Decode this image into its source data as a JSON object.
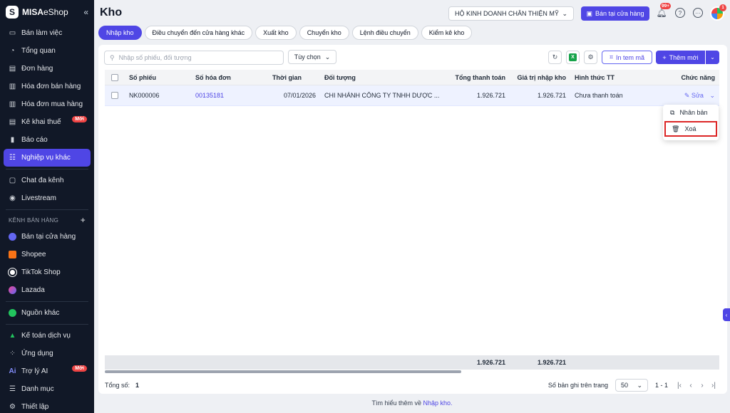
{
  "sidebar": {
    "brand": "MISA",
    "brand_suffix": "eShop",
    "items": [
      {
        "label": "Bán làm việc",
        "icon": "desk-icon"
      },
      {
        "label": "Tổng quan",
        "icon": "dashboard-icon"
      },
      {
        "label": "Đơn hàng",
        "icon": "order-icon"
      },
      {
        "label": "Hóa đơn bán hàng",
        "icon": "invoice-icon"
      },
      {
        "label": "Hóa đơn mua hàng",
        "icon": "purchase-invoice-icon"
      },
      {
        "label": "Kê khai thuế",
        "icon": "tax-icon",
        "badge": "Mới"
      },
      {
        "label": "Báo cáo",
        "icon": "report-icon"
      },
      {
        "label": "Nghiệp vụ khác",
        "icon": "operations-icon",
        "active": true
      }
    ],
    "items2": [
      {
        "label": "Chat đa kênh",
        "icon": "chat-icon"
      },
      {
        "label": "Livestream",
        "icon": "livestream-icon"
      }
    ],
    "channels_title": "KÊNH BÁN HÀNG",
    "channels": [
      {
        "label": "Bán tại cửa hàng",
        "color": "#6366f1"
      },
      {
        "label": "Shopee",
        "color": "#f97316"
      },
      {
        "label": "TikTok Shop",
        "color": "#ffffff"
      },
      {
        "label": "Lazada",
        "color": "#ec4899"
      }
    ],
    "other_source": "Nguồn khác",
    "items3": [
      {
        "label": "Kế toán dịch vụ",
        "icon": "accounting-icon"
      },
      {
        "label": "Ứng dụng",
        "icon": "apps-icon"
      },
      {
        "label": "Trợ lý AI",
        "icon": "ai-icon",
        "badge": "Mới"
      },
      {
        "label": "Danh mục",
        "icon": "catalog-icon"
      },
      {
        "label": "Thiết lập",
        "icon": "settings-icon"
      }
    ]
  },
  "header": {
    "title": "Kho",
    "store": "HỘ KINH DOANH CHÂN THIỆN MỸ",
    "sell_button": "Bán tại cửa hàng",
    "notif_count": "99+",
    "avatar_badge": "1"
  },
  "tabs": [
    "Nhập kho",
    "Điều chuyển đến cửa hàng khác",
    "Xuất kho",
    "Chuyển kho",
    "Lệnh điều chuyển",
    "Kiểm kê kho"
  ],
  "toolbar": {
    "search_placeholder": "Nhập số phiếu, đối tượng",
    "filter_label": "Tùy chọn",
    "excel_label": "X",
    "print_label": "In tem mã",
    "add_label": "Thêm mới"
  },
  "table": {
    "columns": [
      "Số phiếu",
      "Số hóa đơn",
      "Thời gian",
      "Đối tượng",
      "Tổng thanh toán",
      "Giá trị nhập kho",
      "Hình thức TT",
      "Chức năng"
    ],
    "rows": [
      {
        "so_phieu": "NK000006",
        "so_hoa_don": "00135181",
        "thoi_gian": "07/01/2026",
        "doi_tuong": "CHI NHÁNH CÔNG TY TNHH DƯỢC ...",
        "tong_tt": "1.926.721",
        "gia_tri": "1.926.721",
        "hinh_thuc": "Chưa thanh toán",
        "action": "Sửa"
      }
    ]
  },
  "dropdown": {
    "duplicate": "Nhân bản",
    "delete": "Xoá"
  },
  "summary": {
    "tong_tt": "1.926.721",
    "gia_tri": "1.926.721"
  },
  "footer": {
    "total_label": "Tổng số:",
    "total_value": "1",
    "per_page_label": "Số bản ghi trên trang",
    "per_page": "50",
    "range": "1 - 1"
  },
  "learn_more": {
    "text": "Tìm hiểu thêm về",
    "link": "Nhập kho."
  },
  "colors": {
    "accent": "#4f46e5",
    "sidebar": "#111827",
    "danger": "#dc2626"
  }
}
